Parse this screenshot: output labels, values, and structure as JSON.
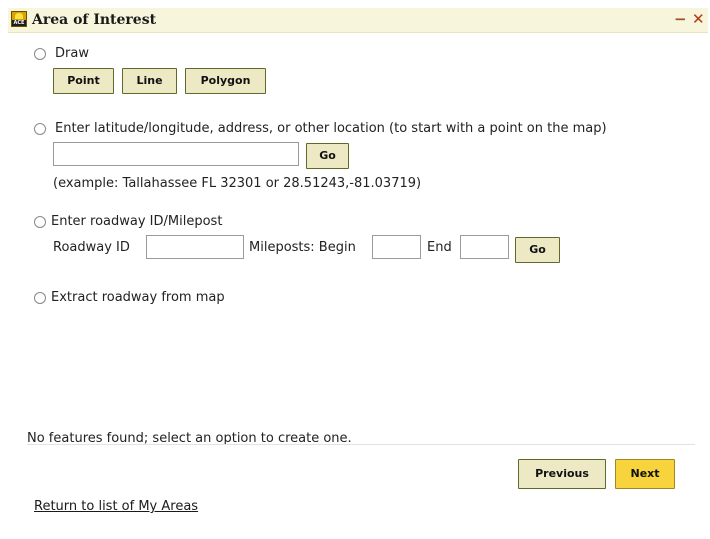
{
  "header": {
    "title": "Area of Interest",
    "minimize_label": "−",
    "close_label": "✕",
    "icon_text": "ACE"
  },
  "draw": {
    "label": "Draw",
    "point": "Point",
    "line": "Line",
    "polygon": "Polygon"
  },
  "location": {
    "label": "Enter latitude/longitude, address, or other location (to start with a point on the map)",
    "go": "Go",
    "example": "(example: Tallahassee FL 32301 or 28.51243,-81.03719)"
  },
  "roadway": {
    "label": "Enter roadway ID/Milepost",
    "roadway_id_label": "Roadway ID",
    "mileposts_begin_label": "Mileposts: Begin",
    "end_label": "End",
    "go": "Go"
  },
  "extract": {
    "label": "Extract roadway from map"
  },
  "status": {
    "message": "No features found; select an option to create one."
  },
  "footer": {
    "previous": "Previous",
    "next": "Next",
    "return_link": "Return to list of My Areas"
  },
  "colors": {
    "header_bg": "#f7f5dc",
    "button_bg": "#ede9c4",
    "next_bg": "#f7d43c",
    "close_color": "#b03a12"
  }
}
